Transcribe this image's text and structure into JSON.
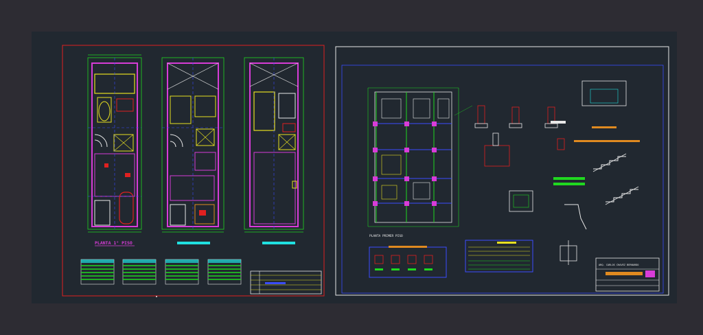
{
  "drawing": {
    "sheet_left": {
      "plan_1_title": "PLANTA 1° PISO"
    },
    "sheet_right": {
      "plan_title": "PLANTA PRIMER PISO",
      "title_block_text": "ARQ. CARLOS CHAVEZ BERNARDO"
    }
  },
  "colors": {
    "background": "#2d2c33",
    "model_space": "#212830",
    "sheet_left_border": "#e02020",
    "sheet_right_border": "#e8e8e8",
    "wall_magenta": "#d83cd8",
    "wall_yellow": "#e8e020",
    "dim_green": "#20d820",
    "axis_blue": "#3a4cff",
    "text_cyan": "#20e0e0",
    "fixture_red": "#e02020",
    "white": "#e8e8e8",
    "orange": "#e08a20"
  }
}
